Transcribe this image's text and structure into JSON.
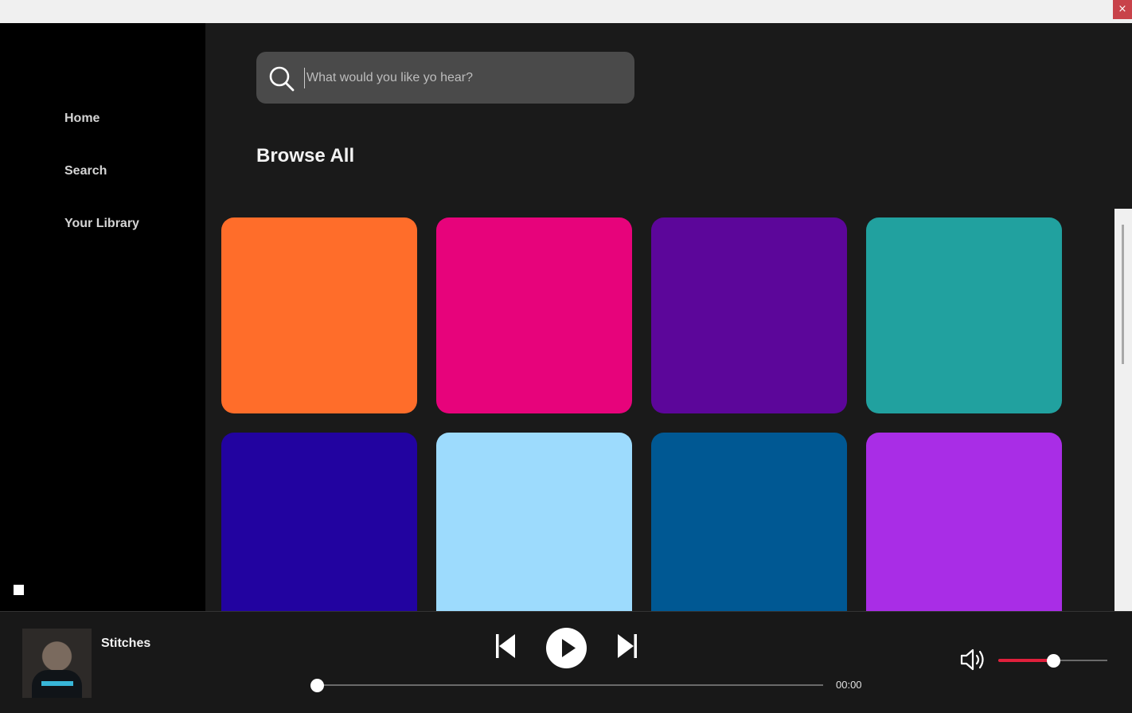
{
  "window": {
    "close_label": "×"
  },
  "sidebar": {
    "items": [
      {
        "label": "Home"
      },
      {
        "label": "Search"
      },
      {
        "label": "Your Library"
      }
    ]
  },
  "search": {
    "placeholder": "What would you like yo hear?",
    "value": ""
  },
  "main": {
    "title": "Browse All",
    "tiles": [
      {
        "color": "#ff6d2a"
      },
      {
        "color": "#e7037b"
      },
      {
        "color": "#5c069a"
      },
      {
        "color": "#21a19f"
      },
      {
        "color": "#2203a0"
      },
      {
        "color": "#9ddbfd"
      },
      {
        "color": "#005893"
      },
      {
        "color": "#a92de6"
      }
    ]
  },
  "player": {
    "track_title": "Stitches",
    "time": "00:00",
    "progress": 0,
    "volume": 0.5,
    "accent_color": "#e0203c"
  }
}
